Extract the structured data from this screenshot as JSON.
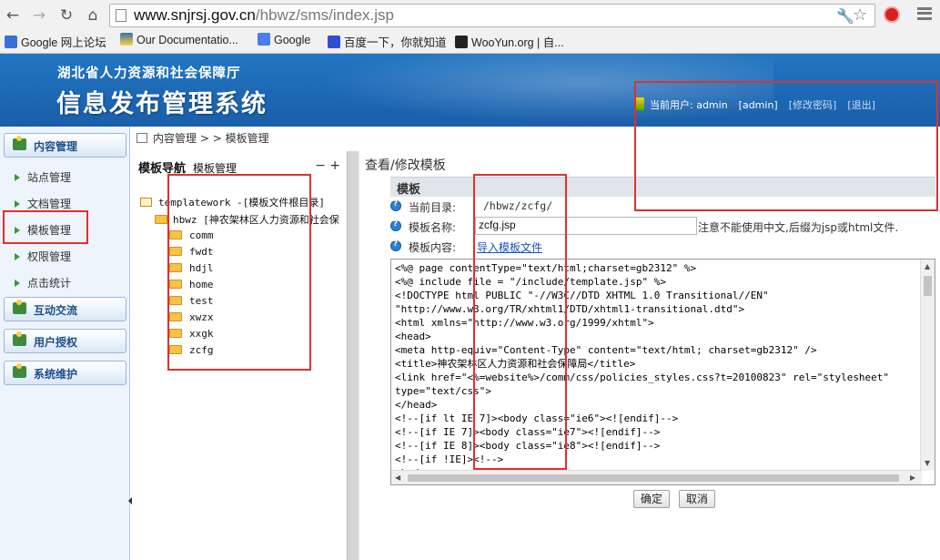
{
  "browser": {
    "url_host": "www.snjrsj.gov.cn",
    "url_path": "/hbwz/sms/index.jsp",
    "bookmarks": [
      "Google 网上论坛",
      "Our Documentatio...",
      "Google",
      "百度一下，你就知道",
      "WooYun.org | 自..."
    ]
  },
  "header": {
    "org_name": "湖北省人力资源和社会保障厅",
    "system_title": "信息发布管理系统",
    "user_label": "当前用户: admin",
    "user_role": "[admin]",
    "change_password": "[修改密码]",
    "logout": "[退出]"
  },
  "sidebar": {
    "groups": [
      "内容管理",
      "互动交流",
      "用户授权",
      "系统维护"
    ],
    "items": [
      "站点管理",
      "文档管理",
      "模板管理",
      "权限管理",
      "点击统计"
    ]
  },
  "breadcrumb": {
    "section": "内容管理",
    "separator": ">",
    "page": "模板管理"
  },
  "tree": {
    "title": "模板导航",
    "subtitle": "模板管理",
    "controls": "− +",
    "root": "templatework -[模板文件根目录]",
    "site": "hbwz [神农架林区人力资源和社会保",
    "folders": [
      "comm",
      "fwdt",
      "hdjl",
      "home",
      "test",
      "xwzx",
      "xxgk",
      "zcfg"
    ]
  },
  "panel": {
    "title": "查看/修改模板",
    "section": "模板",
    "dir_label": "当前目录:",
    "dir_value": "/hbwz/zcfg/",
    "name_label": "模板名称:",
    "name_value": "zcfg.jsp",
    "name_hint": "注意不能使用中文,后缀为jsp或html文件.",
    "content_label": "模板内容:",
    "import_link": "导入模板文件",
    "code": "<%@ page contentType=\"text/html;charset=gb2312\" %>\n<%@ include file = \"/include/template.jsp\" %>\n<!DOCTYPE html PUBLIC \"-//W3C//DTD XHTML 1.0 Transitional//EN\"\n\"http://www.w3.org/TR/xhtml1/DTD/xhtml1-transitional.dtd\">\n<html xmlns=\"http://www.w3.org/1999/xhtml\">\n<head>\n<meta http-equiv=\"Content-Type\" content=\"text/html; charset=gb2312\" />\n<title>神农架林区人力资源和社会保障局</title>\n<link href=\"<%=website%>/comm/css/policies_styles.css?t=20100823\" rel=\"stylesheet\"\ntype=\"text/css\">\n</head>\n<!--[if lt IE 7]><body class=\"ie6\"><![endif]-->\n<!--[if IE 7]><body class=\"ie7\"><![endif]-->\n<!--[if IE 8]><body class=\"ie8\"><![endif]-->\n<!--[if !IE]><!-->\n<body>",
    "ok_button": "确定",
    "cancel_button": "取消"
  },
  "colors": {
    "header_blue": "#1d67b4",
    "annotation_red": "#e03030",
    "sidebar_bg": "#eef4fb"
  }
}
